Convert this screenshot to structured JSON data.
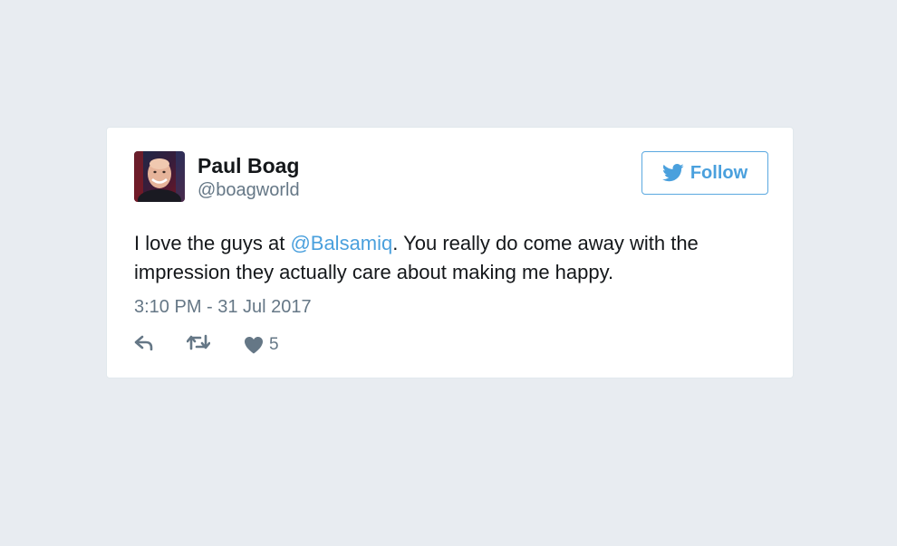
{
  "tweet": {
    "author_name": "Paul Boag",
    "author_handle": "@boagworld",
    "follow_label": "Follow",
    "text_before": "I love the guys at ",
    "mention": "@Balsamiq",
    "text_after": ". You really do come away with the impression they actually care about making me happy.",
    "timestamp": "3:10 PM - 31 Jul 2017",
    "like_count": "5"
  },
  "icons": {
    "follow": "twitter-bird-icon",
    "reply": "reply-icon",
    "retweet": "retweet-icon",
    "like": "heart-icon"
  },
  "colors": {
    "background": "#e8ecf1",
    "link": "#4aa0dd",
    "muted": "#657786",
    "text": "#14171a"
  }
}
